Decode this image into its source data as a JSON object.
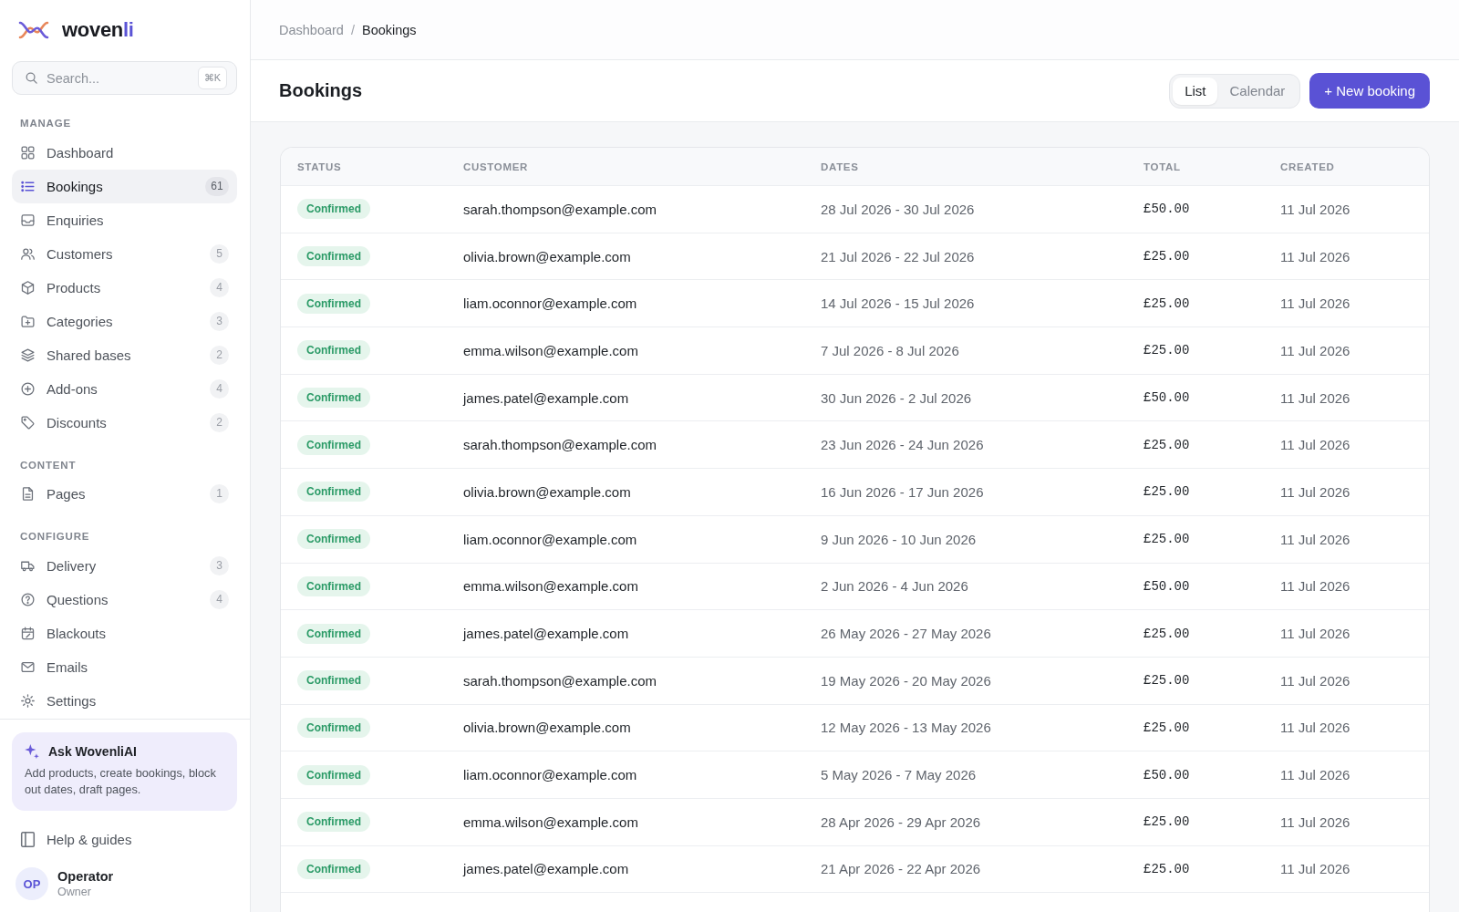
{
  "sidebar": {
    "brand": {
      "text": "woven",
      "accent": "li"
    },
    "search": {
      "placeholder": "Search...",
      "shortcut": "⌘K"
    },
    "sections": [
      {
        "heading": "MANAGE",
        "items": [
          {
            "label": "Dashboard",
            "selected": false
          },
          {
            "label": "Bookings",
            "count": "61",
            "selected": true
          },
          {
            "label": "Enquiries",
            "selected": false
          },
          {
            "label": "Customers",
            "count": "5",
            "selected": false
          },
          {
            "label": "Products",
            "count": "4",
            "selected": false
          },
          {
            "label": "Categories",
            "count": "3",
            "selected": false
          },
          {
            "label": "Shared bases",
            "count": "2",
            "selected": false
          },
          {
            "label": "Add-ons",
            "count": "4",
            "selected": false
          },
          {
            "label": "Discounts",
            "count": "2",
            "selected": false
          }
        ]
      },
      {
        "heading": "CONTENT",
        "items": [
          {
            "label": "Pages",
            "count": "1",
            "selected": false
          }
        ]
      },
      {
        "heading": "CONFIGURE",
        "items": [
          {
            "label": "Delivery",
            "count": "3",
            "selected": false
          },
          {
            "label": "Questions",
            "count": "4",
            "selected": false
          },
          {
            "label": "Blackouts",
            "selected": false
          },
          {
            "label": "Emails",
            "selected": false
          },
          {
            "label": "Settings",
            "selected": false
          }
        ]
      }
    ],
    "ask_ai": {
      "title": "Ask WovenliAI",
      "description": "Add products, create bookings, block out dates, draft pages."
    },
    "help": "Help & guides",
    "user": {
      "initials": "OP",
      "name": "Operator",
      "role": "Owner"
    }
  },
  "breadcrumb": {
    "items": [
      "Dashboard",
      "Bookings"
    ],
    "separator": "/"
  },
  "page_header": {
    "title": "Bookings",
    "view_toggle": [
      {
        "label": "List",
        "selected": true
      },
      {
        "label": "Calendar",
        "selected": false
      }
    ],
    "new_button": "+ New booking"
  },
  "table": {
    "columns": [
      "STATUS",
      "CUSTOMER",
      "DATES",
      "TOTAL",
      "CREATED"
    ],
    "rows": [
      {
        "status": "Confirmed",
        "customer": "sarah.thompson@example.com",
        "dates": "28 Jul 2026 - 30 Jul 2026",
        "total": "£50.00",
        "created": "11 Jul 2026"
      },
      {
        "status": "Confirmed",
        "customer": "olivia.brown@example.com",
        "dates": "21 Jul 2026 - 22 Jul 2026",
        "total": "£25.00",
        "created": "11 Jul 2026"
      },
      {
        "status": "Confirmed",
        "customer": "liam.oconnor@example.com",
        "dates": "14 Jul 2026 - 15 Jul 2026",
        "total": "£25.00",
        "created": "11 Jul 2026"
      },
      {
        "status": "Confirmed",
        "customer": "emma.wilson@example.com",
        "dates": "7 Jul 2026 - 8 Jul 2026",
        "total": "£25.00",
        "created": "11 Jul 2026"
      },
      {
        "status": "Confirmed",
        "customer": "james.patel@example.com",
        "dates": "30 Jun 2026 - 2 Jul 2026",
        "total": "£50.00",
        "created": "11 Jul 2026"
      },
      {
        "status": "Confirmed",
        "customer": "sarah.thompson@example.com",
        "dates": "23 Jun 2026 - 24 Jun 2026",
        "total": "£25.00",
        "created": "11 Jul 2026"
      },
      {
        "status": "Confirmed",
        "customer": "olivia.brown@example.com",
        "dates": "16 Jun 2026 - 17 Jun 2026",
        "total": "£25.00",
        "created": "11 Jul 2026"
      },
      {
        "status": "Confirmed",
        "customer": "liam.oconnor@example.com",
        "dates": "9 Jun 2026 - 10 Jun 2026",
        "total": "£25.00",
        "created": "11 Jul 2026"
      },
      {
        "status": "Confirmed",
        "customer": "emma.wilson@example.com",
        "dates": "2 Jun 2026 - 4 Jun 2026",
        "total": "£50.00",
        "created": "11 Jul 2026"
      },
      {
        "status": "Confirmed",
        "customer": "james.patel@example.com",
        "dates": "26 May 2026 - 27 May 2026",
        "total": "£25.00",
        "created": "11 Jul 2026"
      },
      {
        "status": "Confirmed",
        "customer": "sarah.thompson@example.com",
        "dates": "19 May 2026 - 20 May 2026",
        "total": "£25.00",
        "created": "11 Jul 2026"
      },
      {
        "status": "Confirmed",
        "customer": "olivia.brown@example.com",
        "dates": "12 May 2026 - 13 May 2026",
        "total": "£25.00",
        "created": "11 Jul 2026"
      },
      {
        "status": "Confirmed",
        "customer": "liam.oconnor@example.com",
        "dates": "5 May 2026 - 7 May 2026",
        "total": "£50.00",
        "created": "11 Jul 2026"
      },
      {
        "status": "Confirmed",
        "customer": "emma.wilson@example.com",
        "dates": "28 Apr 2026 - 29 Apr 2026",
        "total": "£25.00",
        "created": "11 Jul 2026"
      },
      {
        "status": "Confirmed",
        "customer": "james.patel@example.com",
        "dates": "21 Apr 2026 - 22 Apr 2026",
        "total": "£25.00",
        "created": "11 Jul 2026"
      }
    ]
  }
}
